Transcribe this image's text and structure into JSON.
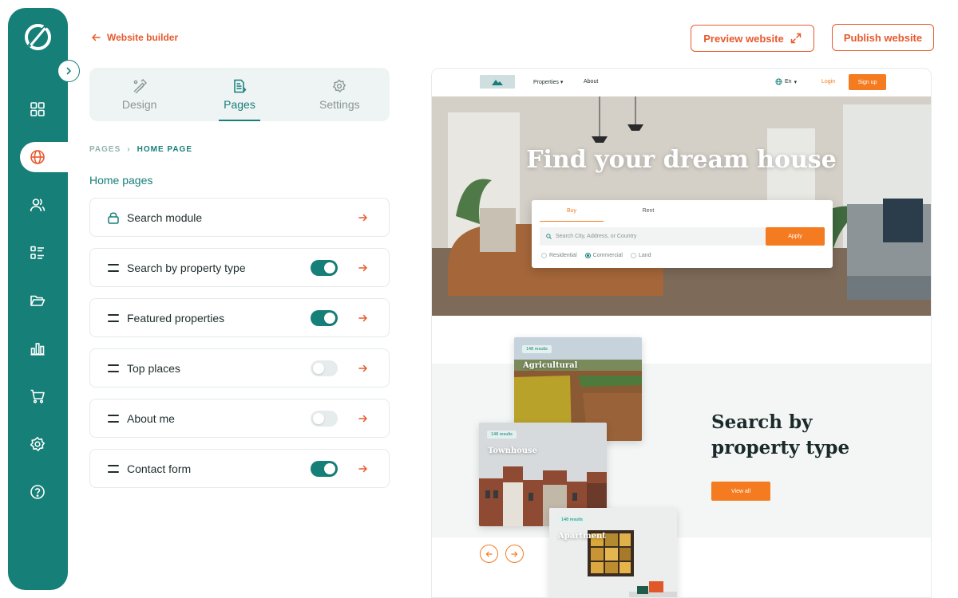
{
  "sidebar": {
    "items": [
      {
        "icon": "dashboard-icon"
      },
      {
        "icon": "globe-icon",
        "active": true
      },
      {
        "icon": "users-icon"
      },
      {
        "icon": "list-icon"
      },
      {
        "icon": "folder-icon"
      },
      {
        "icon": "chart-icon"
      },
      {
        "icon": "cart-icon"
      },
      {
        "icon": "settings-icon"
      },
      {
        "icon": "help-icon"
      }
    ]
  },
  "header": {
    "back_label": "Website builder",
    "preview_label": "Preview website",
    "publish_label": "Publish website"
  },
  "tabs": [
    {
      "label": "Design",
      "icon": "design-icon"
    },
    {
      "label": "Pages",
      "icon": "pages-icon",
      "active": true
    },
    {
      "label": "Settings",
      "icon": "gear-icon"
    }
  ],
  "breadcrumb": {
    "root": "PAGES",
    "current": "HOME PAGE"
  },
  "section_title": "Home pages",
  "modules": [
    {
      "label": "Search module",
      "locked": true
    },
    {
      "label": "Search by property type",
      "enabled": true
    },
    {
      "label": "Featured properties",
      "enabled": true
    },
    {
      "label": "Top places",
      "enabled": false
    },
    {
      "label": "About me",
      "enabled": false
    },
    {
      "label": "Contact form",
      "enabled": true
    }
  ],
  "preview": {
    "nav": {
      "properties": "Properties",
      "about": "About",
      "lang": "En",
      "login": "Login",
      "signup": "Sign up"
    },
    "hero_title": "Find your dream house",
    "search": {
      "tab_buy": "Buy",
      "tab_rent": "Rent",
      "placeholder": "Search City, Address, or Country",
      "apply": "Apply",
      "options": [
        "Residential",
        "Commercial",
        "Land"
      ],
      "selected": "Commercial"
    },
    "section_heading": "Search by property type",
    "view_all": "View all",
    "cards": [
      {
        "badge": "148 results",
        "title": "Agricultural"
      },
      {
        "badge": "148 results",
        "title": "Townhouse"
      },
      {
        "badge": "148 results",
        "title": "Apartment"
      }
    ]
  },
  "colors": {
    "brand": "#157f78",
    "accent": "#e8592c",
    "cta": "#f47b20"
  }
}
